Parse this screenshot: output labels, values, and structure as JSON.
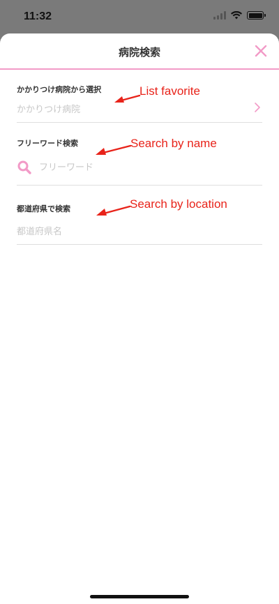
{
  "status": {
    "time": "11:32"
  },
  "header": {
    "title": "病院検索",
    "close_icon": "close-icon"
  },
  "sections": [
    {
      "label": "かかりつけ病院から選択",
      "value_placeholder": "かかりつけ病院",
      "icon": "chevron-right-icon"
    },
    {
      "label": "フリーワード検索",
      "placeholder": "フリーワード",
      "icon": "search-icon"
    },
    {
      "label": "都道府県で検索",
      "value_placeholder": "都道府県名"
    }
  ],
  "annotations": [
    "List favorite",
    "Search by name",
    "Search by location"
  ],
  "colors": {
    "accent": "#f29ac7",
    "annotation": "#e8231a"
  }
}
